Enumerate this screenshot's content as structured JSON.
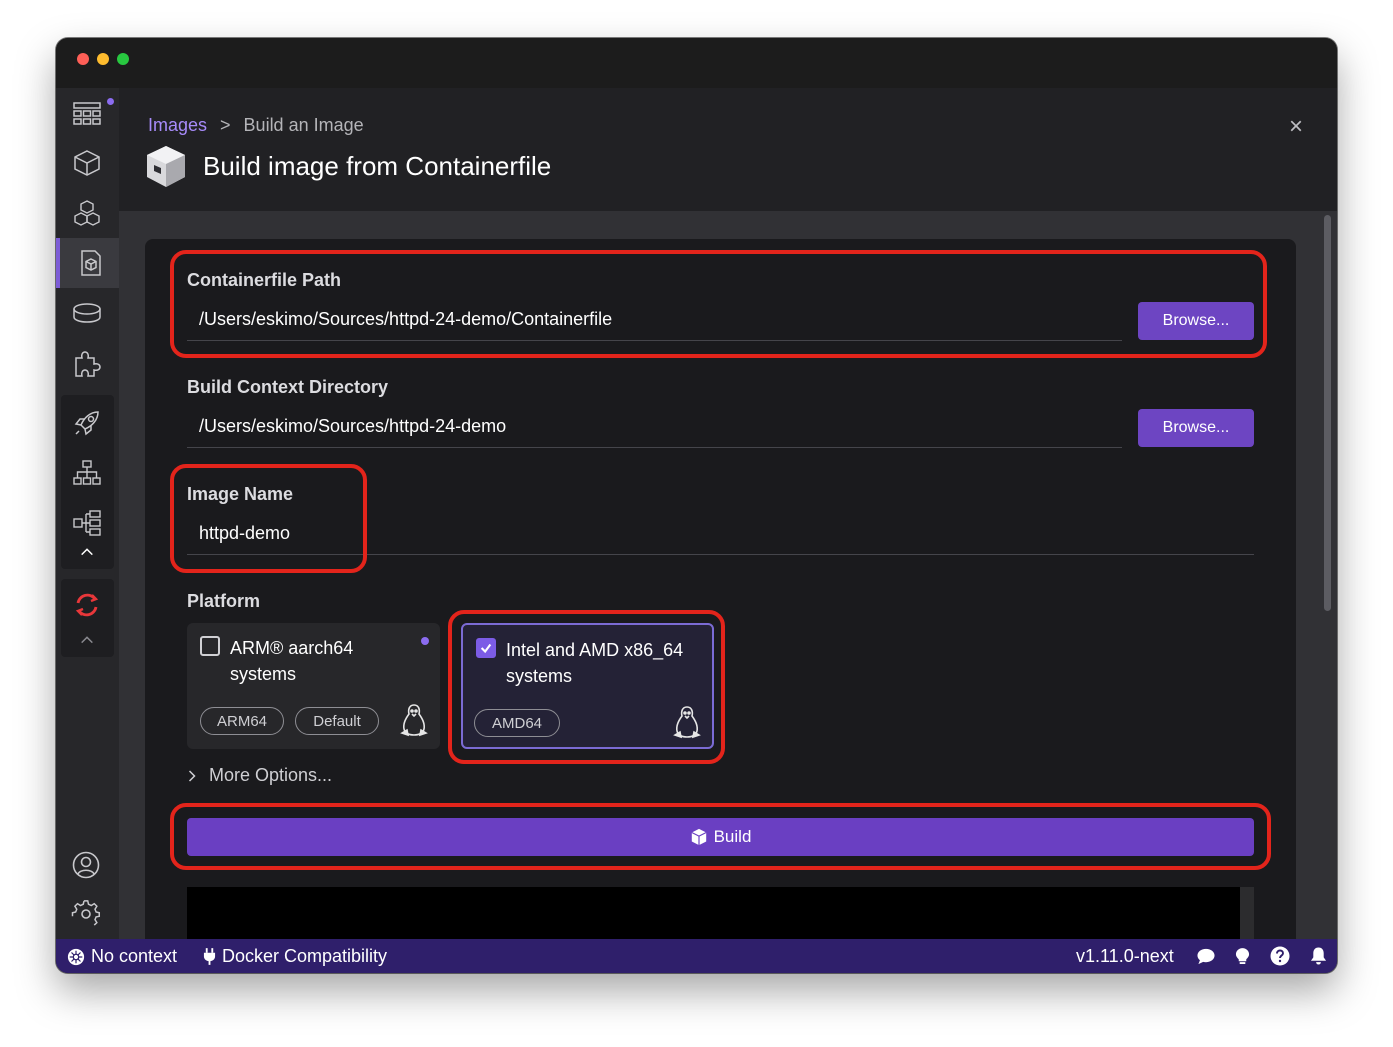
{
  "window": {
    "traffic_lights": [
      "#fe5f57",
      "#febc2e",
      "#28c840"
    ]
  },
  "sidebar": {
    "items": [
      {
        "icon": "dashboard-icon"
      },
      {
        "icon": "container-icon"
      },
      {
        "icon": "pods-icon"
      },
      {
        "icon": "images-icon",
        "active": true
      },
      {
        "icon": "volumes-icon"
      },
      {
        "icon": "extensions-icon"
      },
      {
        "icon": "deployments-icon"
      },
      {
        "icon": "services-icon"
      },
      {
        "icon": "ingresses-icon"
      }
    ],
    "bottom": [
      {
        "icon": "account-icon"
      },
      {
        "icon": "settings-icon"
      }
    ]
  },
  "header": {
    "breadcrumb_link": "Images",
    "breadcrumb_sep": ">",
    "breadcrumb_current": "Build an Image",
    "title": "Build image from Containerfile",
    "close": "×"
  },
  "form": {
    "containerfile_label": "Containerfile Path",
    "containerfile_value": "/Users/eskimo/Sources/httpd-24-demo/Containerfile",
    "context_label": "Build Context Directory",
    "context_value": "/Users/eskimo/Sources/httpd-24-demo",
    "browse_label": "Browse...",
    "image_name_label": "Image Name",
    "image_name_value": "httpd-demo",
    "platform_label": "Platform",
    "platforms": [
      {
        "title": "ARM® aarch64 systems",
        "badges": [
          "ARM64",
          "Default"
        ],
        "checked": false
      },
      {
        "title": "Intel and AMD x86_64 systems",
        "badges": [
          "AMD64"
        ],
        "checked": true
      }
    ],
    "more_options": "More Options...",
    "build_label": "Build"
  },
  "status_bar": {
    "context": "No context",
    "compat": "Docker Compatibility",
    "version": "v1.11.0-next"
  },
  "colors": {
    "accent": "#6d45c2",
    "highlight": "#e3241b",
    "status_bar": "#2f1f6b"
  }
}
